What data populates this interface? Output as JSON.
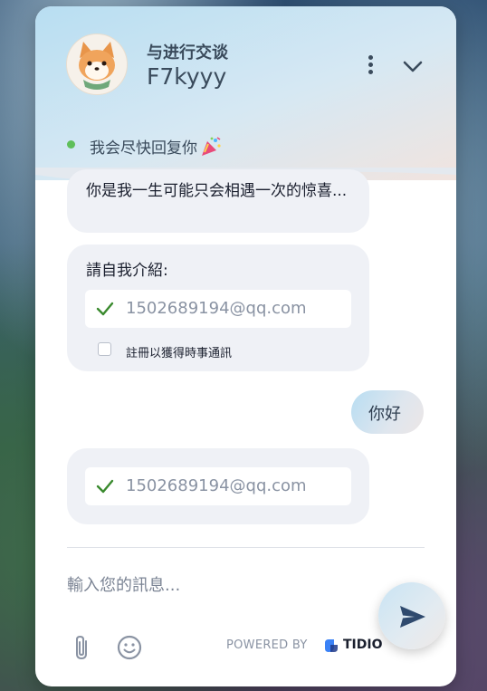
{
  "header": {
    "subtitle": "与进行交谈",
    "agent_name": "F7kyyy",
    "status_text": "我会尽快回复你"
  },
  "messages": {
    "agent_text": "你是我一生可能只会相遇一次的惊喜...",
    "form_title": "請自我介紹:",
    "email_value": "1502689194@qq.com",
    "optin_label": "註冊以獲得時事通訊",
    "user_message": "你好",
    "email_value_2": "1502689194@qq.com"
  },
  "footer": {
    "input_placeholder": "輸入您的訊息...",
    "powered_by": "POWERED BY",
    "brand": "TIDIO"
  },
  "colors": {
    "status_online": "#5fbf5a",
    "check": "#3a8a2e",
    "text_dark": "#1a1f2e",
    "bubble_bg": "#eff1f6"
  },
  "icons": [
    "avatar-shiba",
    "more-vertical-icon",
    "chevron-down-icon",
    "party-popper-icon",
    "check-icon",
    "send-icon",
    "paperclip-icon",
    "emoji-icon",
    "tidio-logo-icon"
  ]
}
